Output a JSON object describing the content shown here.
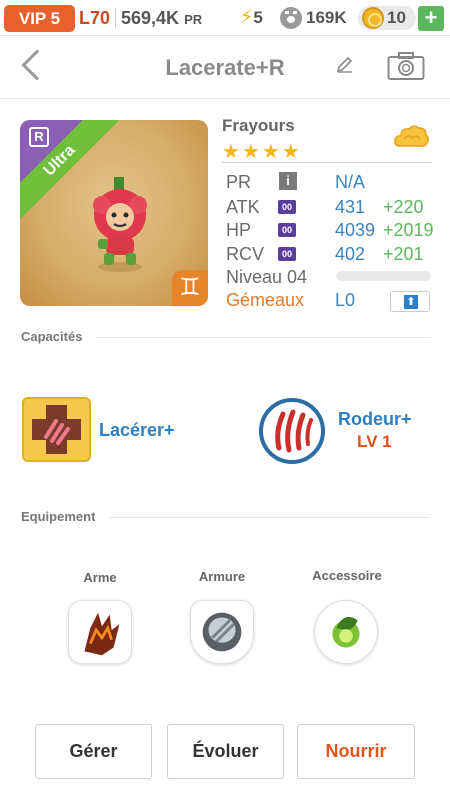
{
  "status_bar": {
    "vip": "VIP 5",
    "level": "L70",
    "pr_value": "569,4K",
    "pr_unit": "PR",
    "energy": "5",
    "paws": "169K",
    "coins": "10",
    "plus": "+"
  },
  "header": {
    "title": "Lacerate+R"
  },
  "monster": {
    "rarity_letter": "R",
    "rarity_tag": "Ultra",
    "zodiac_symbol": "♊",
    "name": "Frayours",
    "stars": "★★★★",
    "stats": {
      "pr_label": "PR",
      "pr_info": "i",
      "pr_value": "N/A",
      "atk_label": "ATK",
      "atk_value": "431",
      "atk_bonus": "+220",
      "hp_label": "HP",
      "hp_value": "4039",
      "hp_bonus": "+2019",
      "rcv_label": "RCV",
      "rcv_value": "402",
      "rcv_bonus": "+201",
      "stat_icon": "00"
    },
    "level_label": "Niveau 04",
    "level_progress": 0,
    "zodiac_name": "Gémeaux",
    "zodiac_level": "L0",
    "upgrade_arrow": "⬆"
  },
  "capacites": {
    "title": "Capacités",
    "skill_name": "Lacérer+",
    "trait_name": "Rodeur+",
    "trait_level": "LV 1"
  },
  "equipement": {
    "title": "Equipement",
    "slots": [
      {
        "label": "Arme"
      },
      {
        "label": "Armure"
      },
      {
        "label": "Accessoire"
      }
    ]
  },
  "buttons": {
    "manage": "Gérer",
    "evolve": "Évoluer",
    "feed": "Nourrir"
  },
  "colors": {
    "accent_blue": "#2f7fc0",
    "vip_orange": "#e8602c",
    "bonus_green": "#5cb85c",
    "feed_orange": "#e2541b"
  }
}
